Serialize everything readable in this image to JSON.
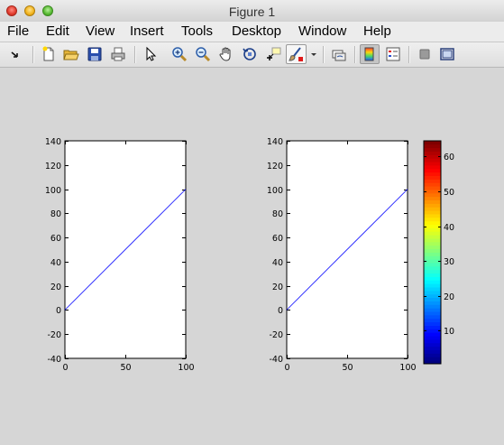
{
  "window": {
    "title": "Figure 1"
  },
  "menubar": {
    "items": [
      "File",
      "Edit",
      "View",
      "Insert",
      "Tools",
      "Desktop",
      "Window",
      "Help"
    ]
  },
  "toolbar": {
    "buttons": [
      {
        "name": "arrow-icon"
      },
      {
        "name": "new-figure-icon"
      },
      {
        "name": "open-file-icon"
      },
      {
        "name": "save-icon"
      },
      {
        "name": "print-icon"
      },
      {
        "name": "pointer-icon"
      },
      {
        "name": "zoom-in-icon"
      },
      {
        "name": "zoom-out-icon"
      },
      {
        "name": "pan-hand-icon"
      },
      {
        "name": "rotate-3d-icon"
      },
      {
        "name": "data-cursor-icon"
      },
      {
        "name": "brush-icon"
      },
      {
        "name": "dropdown-arrow-icon"
      },
      {
        "name": "link-plot-icon"
      },
      {
        "name": "colorbar-icon"
      },
      {
        "name": "legend-icon"
      },
      {
        "name": "hide-plot-tools-icon"
      },
      {
        "name": "show-plot-tools-icon"
      }
    ]
  },
  "chart_data": [
    {
      "type": "line",
      "x": [
        0,
        100
      ],
      "y": [
        0,
        100
      ],
      "xlim": [
        0,
        100
      ],
      "ylim": [
        -40,
        140
      ],
      "xticks": [
        0,
        50,
        100
      ],
      "yticks": [
        -40,
        -20,
        0,
        20,
        40,
        60,
        80,
        100,
        120,
        140
      ],
      "line_color": "#0000ff",
      "grid": false,
      "title": "",
      "xlabel": "",
      "ylabel": ""
    },
    {
      "type": "line",
      "x": [
        0,
        100
      ],
      "y": [
        0,
        100
      ],
      "xlim": [
        0,
        100
      ],
      "ylim": [
        -40,
        140
      ],
      "xticks": [
        0,
        50,
        100
      ],
      "yticks": [
        -40,
        -20,
        0,
        20,
        40,
        60,
        80,
        100,
        120,
        140
      ],
      "line_color": "#0000ff",
      "grid": false,
      "title": "",
      "xlabel": "",
      "ylabel": "",
      "colorbar": {
        "colormap": "jet",
        "clim": [
          1,
          64
        ],
        "ticks": [
          10,
          20,
          30,
          40,
          50,
          60
        ]
      }
    }
  ]
}
